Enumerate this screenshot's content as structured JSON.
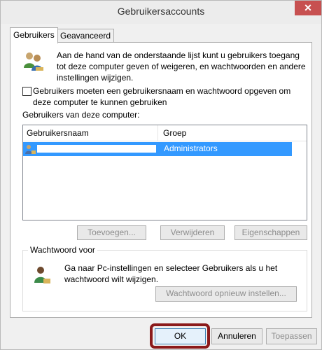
{
  "window": {
    "title": "Gebruikersaccounts",
    "close_glyph": "✕"
  },
  "tabs": [
    {
      "label": "Gebruikers",
      "active": true
    },
    {
      "label": "Geavanceerd",
      "active": false
    }
  ],
  "intro_text": "Aan de hand van de onderstaande lijst kunt u gebruikers toegang tot deze computer geven of weigeren, en wachtwoorden en andere instellingen wijzigen.",
  "require_login_checkbox": {
    "label": "Gebruikers moeten een gebruikersnaam en wachtwoord opgeven om deze computer te kunnen gebruiken",
    "checked": false
  },
  "users_list": {
    "label": "Gebruikers van deze computer:",
    "columns": [
      "Gebruikersnaam",
      "Groep"
    ],
    "rows": [
      {
        "username": "",
        "group": "Administrators",
        "selected": true
      }
    ]
  },
  "list_buttons": {
    "add": "Toevoegen...",
    "remove": "Verwijderen",
    "properties": "Eigenschappen"
  },
  "password_group": {
    "title": "Wachtwoord voor",
    "text": "Ga naar Pc-instellingen en selecteer Gebruikers als u het wachtwoord wilt wijzigen.",
    "reset_button": "Wachtwoord opnieuw instellen..."
  },
  "dialog_buttons": {
    "ok": "OK",
    "cancel": "Annuleren",
    "apply": "Toepassen"
  },
  "icons": {
    "users": "users-icon",
    "user_row": "user-icon",
    "password": "user-key-icon"
  },
  "colors": {
    "selection": "#3399ff",
    "close_button": "#c75050",
    "highlight_annotation": "#8b1a1a"
  }
}
